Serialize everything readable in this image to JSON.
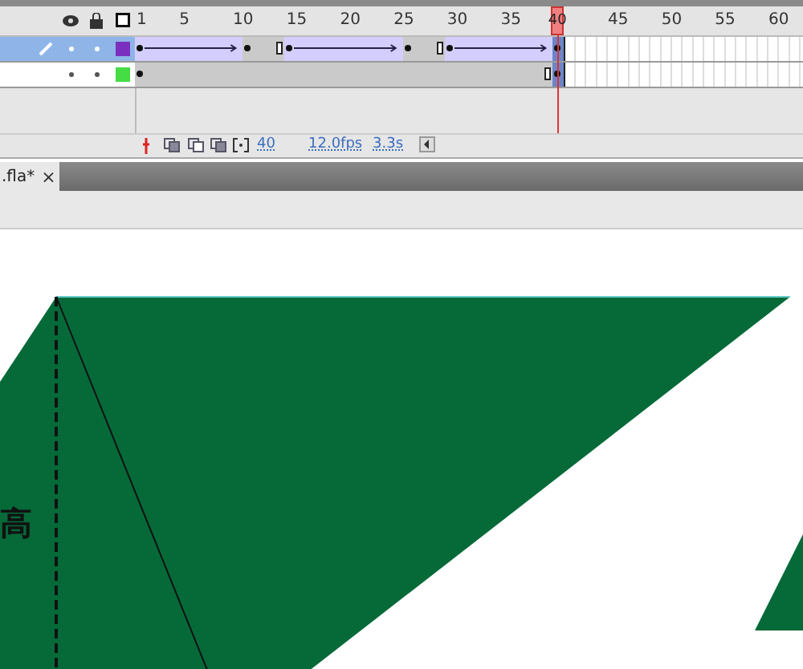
{
  "timeline": {
    "frame_numbers": [
      "1",
      "5",
      "10",
      "15",
      "20",
      "25",
      "30",
      "35",
      "45",
      "50",
      "55",
      "60"
    ],
    "playhead": {
      "label": "40"
    },
    "layers": [
      {
        "selected": true,
        "color": "#7b2fbe",
        "frames": [
          {
            "kind": "tween_key"
          },
          {
            "kind": "tween"
          },
          {
            "kind": "tween"
          },
          {
            "kind": "tween"
          },
          {
            "kind": "tween"
          },
          {
            "kind": "tween"
          },
          {
            "kind": "tween"
          },
          {
            "kind": "tween"
          },
          {
            "kind": "tween"
          },
          {
            "kind": "tween"
          },
          {
            "kind": "key"
          },
          {
            "kind": "hold"
          },
          {
            "kind": "hold"
          },
          {
            "kind": "hold_end"
          },
          {
            "kind": "tween_key"
          },
          {
            "kind": "tween"
          },
          {
            "kind": "tween"
          },
          {
            "kind": "tween"
          },
          {
            "kind": "tween"
          },
          {
            "kind": "tween"
          },
          {
            "kind": "tween"
          },
          {
            "kind": "tween"
          },
          {
            "kind": "tween"
          },
          {
            "kind": "tween"
          },
          {
            "kind": "tween"
          },
          {
            "kind": "key"
          },
          {
            "kind": "hold"
          },
          {
            "kind": "hold"
          },
          {
            "kind": "hold_end"
          },
          {
            "kind": "tween_key"
          },
          {
            "kind": "tween"
          },
          {
            "kind": "tween"
          },
          {
            "kind": "tween"
          },
          {
            "kind": "tween"
          },
          {
            "kind": "tween"
          },
          {
            "kind": "tween"
          },
          {
            "kind": "tween"
          },
          {
            "kind": "tween"
          },
          {
            "kind": "tween"
          },
          {
            "kind": "key"
          }
        ]
      },
      {
        "selected": false,
        "color": "#44dd44",
        "frames": [
          {
            "kind": "key"
          },
          {
            "kind": "hold"
          },
          {
            "kind": "hold"
          },
          {
            "kind": "hold"
          },
          {
            "kind": "hold"
          },
          {
            "kind": "hold"
          },
          {
            "kind": "hold"
          },
          {
            "kind": "hold"
          },
          {
            "kind": "hold"
          },
          {
            "kind": "hold"
          },
          {
            "kind": "hold"
          },
          {
            "kind": "hold"
          },
          {
            "kind": "hold"
          },
          {
            "kind": "hold"
          },
          {
            "kind": "hold"
          },
          {
            "kind": "hold"
          },
          {
            "kind": "hold"
          },
          {
            "kind": "hold"
          },
          {
            "kind": "hold"
          },
          {
            "kind": "hold"
          },
          {
            "kind": "hold"
          },
          {
            "kind": "hold"
          },
          {
            "kind": "hold"
          },
          {
            "kind": "hold"
          },
          {
            "kind": "hold"
          },
          {
            "kind": "hold"
          },
          {
            "kind": "hold"
          },
          {
            "kind": "hold"
          },
          {
            "kind": "hold"
          },
          {
            "kind": "hold"
          },
          {
            "kind": "hold"
          },
          {
            "kind": "hold"
          },
          {
            "kind": "hold"
          },
          {
            "kind": "hold"
          },
          {
            "kind": "hold"
          },
          {
            "kind": "hold"
          },
          {
            "kind": "hold"
          },
          {
            "kind": "hold"
          },
          {
            "kind": "hold_end"
          },
          {
            "kind": "key"
          }
        ]
      }
    ],
    "status": {
      "frame": "40",
      "rate": "12.0fps",
      "time": "3.3s"
    }
  },
  "document_tab": {
    "title": ".fla*",
    "close": "×"
  },
  "stage": {
    "text": "高"
  }
}
